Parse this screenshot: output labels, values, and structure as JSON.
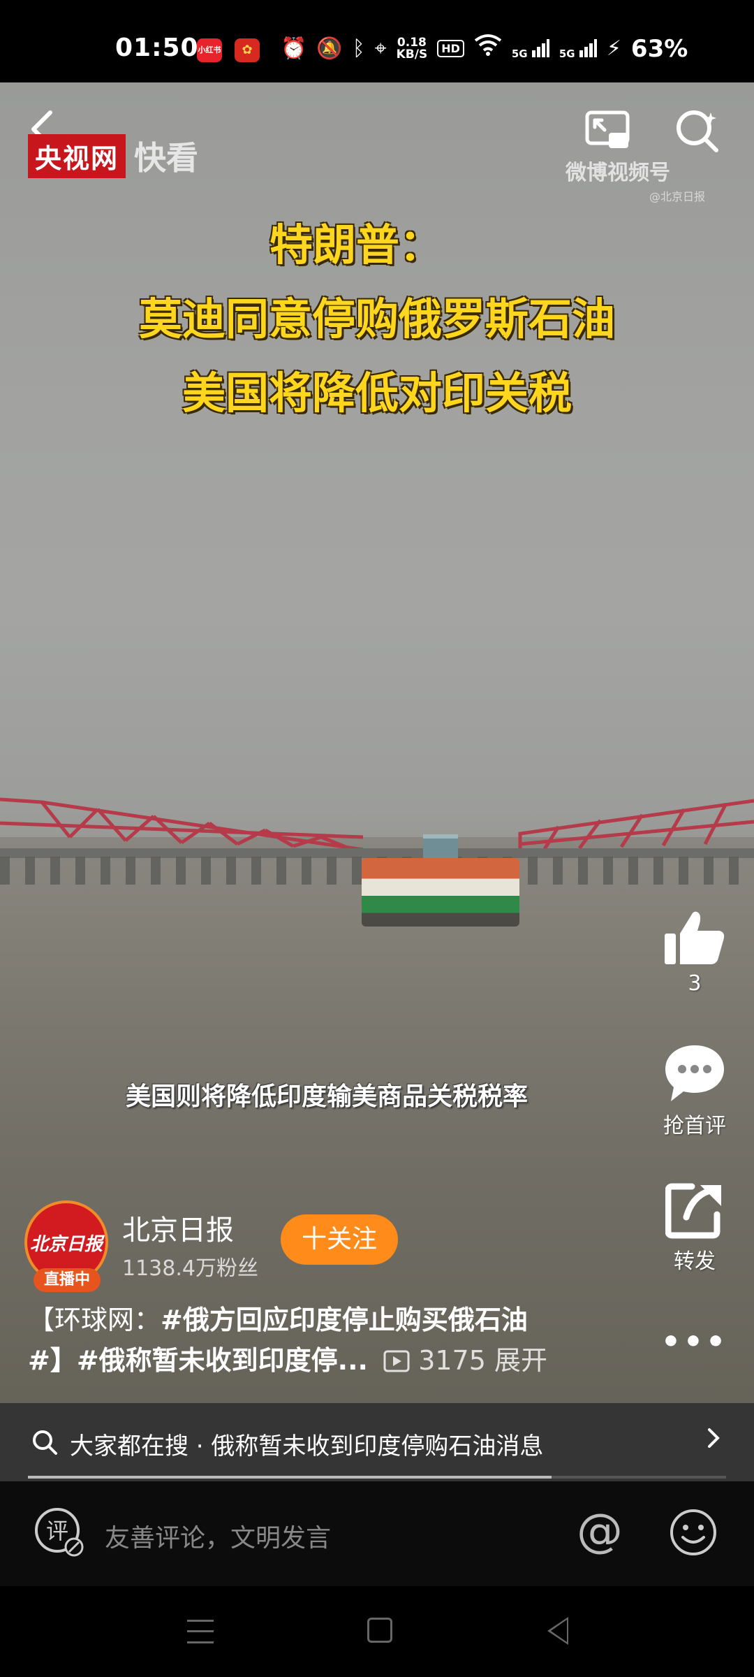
{
  "status_bar": {
    "time": "01:50",
    "app_badge_1": "小红书",
    "net_speed_value": "0.18",
    "net_speed_unit": "KB/S",
    "hd_label": "HD",
    "signal_1": "5G",
    "signal_2": "5G",
    "battery": "63%"
  },
  "video": {
    "logo_text": "央视网",
    "logo_sub": "快看",
    "watermark": "微博视频号",
    "watermark_sub": "@北京日报",
    "headline_line1": "特朗普：",
    "headline_line2": "莫迪同意停购俄罗斯石油",
    "headline_line3": "美国将降低对印关税",
    "subtitle": "美国则将降低印度输美商品关税税率"
  },
  "actions": {
    "like_count": "3",
    "comment_label": "抢首评",
    "share_label": "转发",
    "more_label": "•••"
  },
  "author": {
    "avatar_text": "北京日报",
    "live_badge": "直播中",
    "name": "北京日报",
    "fans": "1138.4万粉丝",
    "follow_label": "十关注"
  },
  "caption": {
    "line1_prefix": "【环球网：",
    "line1_tag": "#俄方回应印度停止购买俄石油",
    "line2_tag": "#】#俄称暂未收到印度停...",
    "play_count": "3175",
    "expand_label": "展开"
  },
  "suggest": {
    "text": "大家都在搜 · 俄称暂未收到印度停购石油消息",
    "progress": 0.75
  },
  "comment_bar": {
    "placeholder": "友善评论，文明发言",
    "at_label": "@"
  },
  "colors": {
    "headline_yellow": "#ffd61e",
    "follow_orange": "#ff8c1a",
    "brand_red": "#c8161d"
  }
}
